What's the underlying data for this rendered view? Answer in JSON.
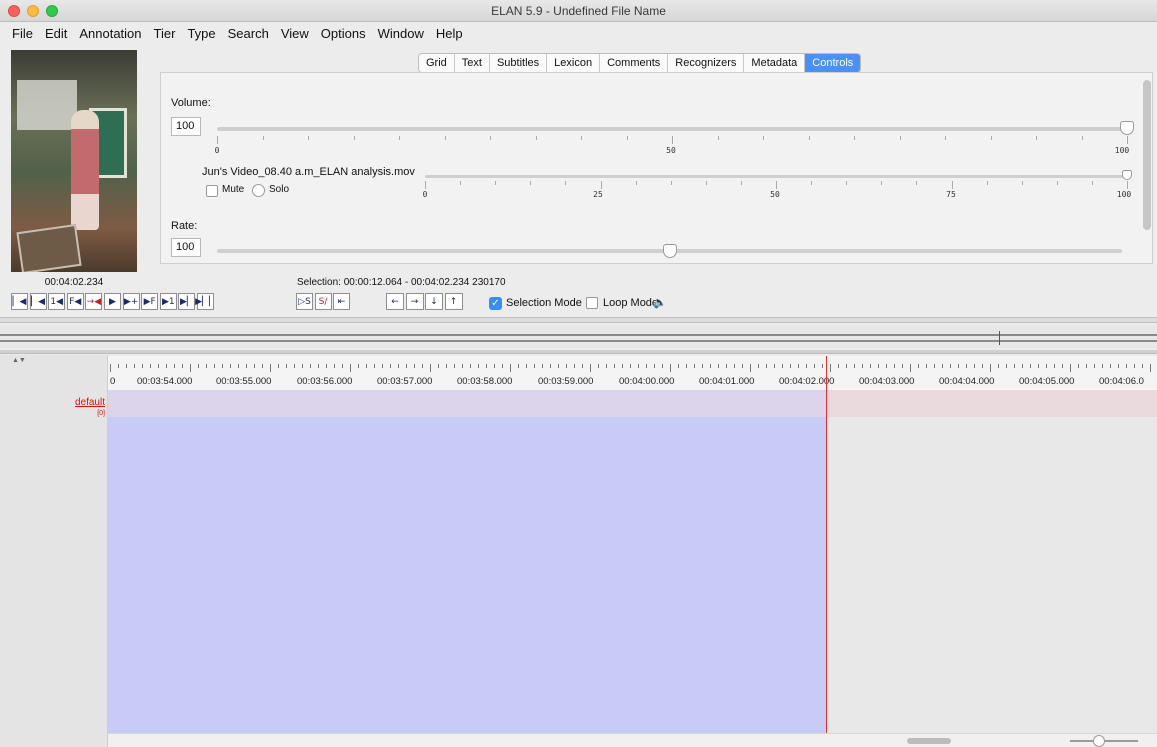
{
  "window": {
    "title": "ELAN 5.9 - Undefined File Name"
  },
  "menu": [
    "File",
    "Edit",
    "Annotation",
    "Tier",
    "Type",
    "Search",
    "View",
    "Options",
    "Window",
    "Help"
  ],
  "tabs": [
    {
      "label": "Grid"
    },
    {
      "label": "Text"
    },
    {
      "label": "Subtitles"
    },
    {
      "label": "Lexicon"
    },
    {
      "label": "Comments"
    },
    {
      "label": "Recognizers"
    },
    {
      "label": "Metadata"
    },
    {
      "label": "Controls",
      "active": true
    }
  ],
  "controls": {
    "volume_label": "Volume:",
    "volume_value": "100",
    "volume_ticks": [
      "0",
      "50",
      "100"
    ],
    "volume_level": 1.0,
    "file_name": "Jun's Video_08.40 a.m_ELAN analysis.mov",
    "file_ticks": [
      "0",
      "25",
      "50",
      "75",
      "100"
    ],
    "file_level": 1.0,
    "mute_label": "Mute",
    "solo_label": "Solo",
    "rate_label": "Rate:",
    "rate_value": "100",
    "rate_level": 0.5
  },
  "player": {
    "timecode": "00:04:02.234",
    "selection": "Selection: 00:00:12.064 - 00:04:02.234  230170",
    "selection_mode_label": "Selection Mode",
    "selection_mode_checked": true,
    "loop_mode_label": "Loop Mode",
    "loop_mode_checked": false,
    "speaker_icon": "speaker-icon",
    "nav_buttons": [
      "▏◀",
      "▏◀",
      "1◀",
      "F◀",
      "→◀",
      "▶",
      "▶+",
      "▶F",
      "▶1",
      "▶▏",
      "▶▏▏"
    ],
    "sel_buttons": [
      "▷S",
      "S∕",
      "⇤"
    ],
    "arrow_buttons": [
      "←",
      "→",
      "↓",
      "↑"
    ]
  },
  "timeline": {
    "ruler_labels": [
      "0",
      "00:03:54.000",
      "00:03:55.000",
      "00:03:56.000",
      "00:03:57.000",
      "00:03:58.000",
      "00:03:59.000",
      "00:04:00.000",
      "00:04:01.000",
      "00:04:02.000",
      "00:04:03.000",
      "00:04:04.000",
      "00:04:05.000",
      "00:04:06.0"
    ],
    "tier_name": "default",
    "tier_count": "[0]",
    "crosshair_color": "#e53030",
    "selection_color": "#c9cbf7"
  }
}
